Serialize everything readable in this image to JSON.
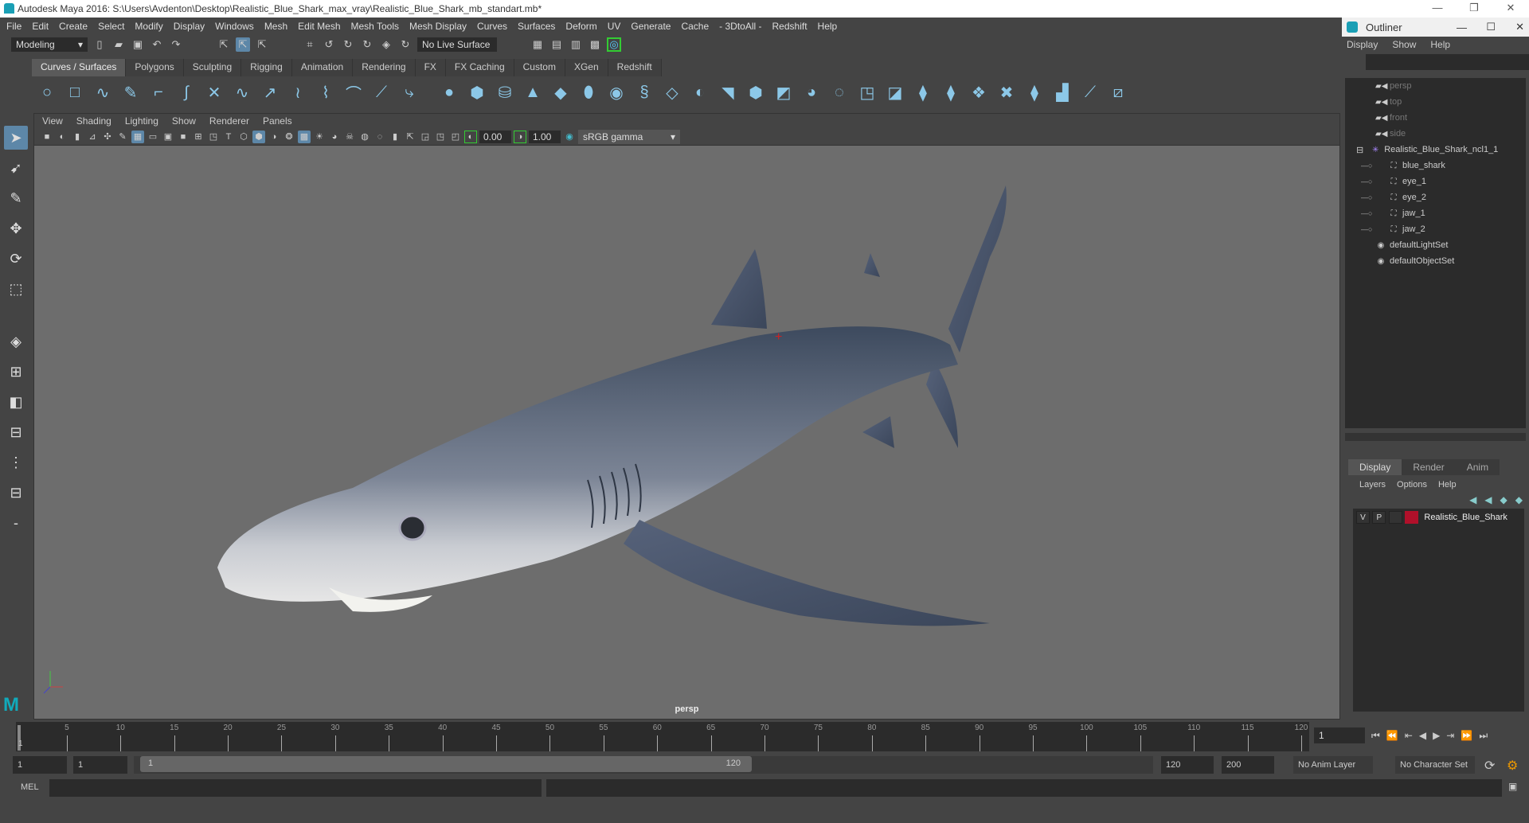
{
  "window": {
    "title": "Autodesk Maya 2016: S:\\Users\\Avdenton\\Desktop\\Realistic_Blue_Shark_max_vray\\Realistic_Blue_Shark_mb_standart.mb*",
    "minimize": "—",
    "maximize": "❐",
    "close": "✕"
  },
  "menubar": [
    "File",
    "Edit",
    "Create",
    "Select",
    "Modify",
    "Display",
    "Windows",
    "Mesh",
    "Edit Mesh",
    "Mesh Tools",
    "Mesh Display",
    "Curves",
    "Surfaces",
    "Deform",
    "UV",
    "Generate",
    "Cache",
    "- 3DtoAll -",
    "Redshift",
    "Help"
  ],
  "statusline": {
    "mode": "Modeling",
    "live_surface": "No Live Surface"
  },
  "shelf": {
    "tabs": [
      "Curves / Surfaces",
      "Polygons",
      "Sculpting",
      "Rigging",
      "Animation",
      "Rendering",
      "FX",
      "FX Caching",
      "Custom",
      "XGen",
      "Redshift"
    ],
    "active": 0
  },
  "viewport": {
    "menu": [
      "View",
      "Shading",
      "Lighting",
      "Show",
      "Renderer",
      "Panels"
    ],
    "exposure": "0.00",
    "gamma": "1.00",
    "color_space": "sRGB gamma",
    "camera": "persp"
  },
  "outliner": {
    "title": "Outliner",
    "menu": [
      "Display",
      "Show",
      "Help"
    ],
    "items": [
      {
        "label": "persp",
        "type": "camera",
        "dim": true,
        "indent": 0
      },
      {
        "label": "top",
        "type": "camera",
        "dim": true,
        "indent": 0
      },
      {
        "label": "front",
        "type": "camera",
        "dim": true,
        "indent": 0
      },
      {
        "label": "side",
        "type": "camera",
        "dim": true,
        "indent": 0
      },
      {
        "label": "Realistic_Blue_Shark_ncl1_1",
        "type": "group",
        "dim": false,
        "indent": 0
      },
      {
        "label": "blue_shark",
        "type": "mesh",
        "dim": false,
        "indent": 1
      },
      {
        "label": "eye_1",
        "type": "mesh",
        "dim": false,
        "indent": 1
      },
      {
        "label": "eye_2",
        "type": "mesh",
        "dim": false,
        "indent": 1
      },
      {
        "label": "jaw_1",
        "type": "mesh",
        "dim": false,
        "indent": 1
      },
      {
        "label": "jaw_2",
        "type": "mesh",
        "dim": false,
        "indent": 1
      },
      {
        "label": "defaultLightSet",
        "type": "set",
        "dim": false,
        "indent": 0
      },
      {
        "label": "defaultObjectSet",
        "type": "set",
        "dim": false,
        "indent": 0
      }
    ]
  },
  "layers": {
    "tabs": [
      "Display",
      "Render",
      "Anim"
    ],
    "menu": [
      "Layers",
      "Options",
      "Help"
    ],
    "row": {
      "v": "V",
      "p": "P",
      "name": "Realistic_Blue_Shark",
      "color": "#b0102a"
    }
  },
  "timeline": {
    "ticks": [
      5,
      10,
      15,
      20,
      25,
      30,
      35,
      40,
      45,
      50,
      55,
      60,
      65,
      70,
      75,
      80,
      85,
      90,
      95,
      100,
      105,
      110,
      115,
      120
    ],
    "current_frame": "1",
    "start_marker": "1"
  },
  "range": {
    "start": "1",
    "anim_start": "1",
    "slider_start": "1",
    "slider_end": "120",
    "end": "120",
    "anim_end": "200",
    "anim_layer": "No Anim Layer",
    "character_set": "No Character Set"
  },
  "command": {
    "language": "MEL"
  }
}
